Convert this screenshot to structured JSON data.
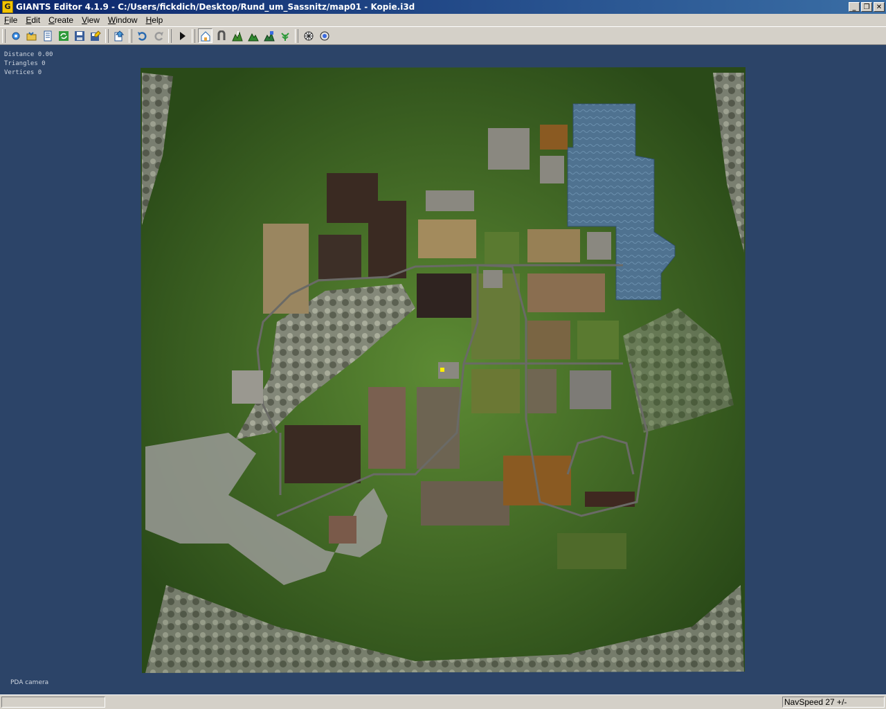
{
  "window": {
    "title": "GIANTS Editor 4.1.9 - C:/Users/fickdich/Desktop/Rund_um_Sassnitz/map01 - Kopie.i3d",
    "icon": "giants-app-icon",
    "controls": [
      "minimize",
      "restore",
      "close"
    ]
  },
  "menu": {
    "items": [
      "File",
      "Edit",
      "Create",
      "View",
      "Window",
      "Help"
    ]
  },
  "toolbar": {
    "buttons": [
      {
        "name": "new-icon"
      },
      {
        "name": "open-icon"
      },
      {
        "name": "document-icon"
      },
      {
        "name": "refresh-icon"
      },
      {
        "name": "save-icon"
      },
      {
        "name": "save-as-icon"
      },
      {
        "name": "import-icon"
      },
      {
        "name": "undo-icon"
      },
      {
        "name": "redo-icon"
      },
      {
        "name": "play-icon"
      },
      {
        "name": "select-mode-icon",
        "active": true
      },
      {
        "name": "move-mode-icon"
      },
      {
        "name": "terrain-sculpt-icon"
      },
      {
        "name": "terrain-paint-icon"
      },
      {
        "name": "terrain-smooth-icon"
      },
      {
        "name": "foliage-paint-icon"
      },
      {
        "name": "render-icon"
      },
      {
        "name": "settings-render-icon"
      }
    ]
  },
  "viewport": {
    "background_color": "#2c4468",
    "stats": {
      "distance": "Distance 0.00",
      "triangles": "Triangles 0",
      "vertices": "Vertices 0"
    },
    "camera_label": "PDA camera",
    "map_colors": {
      "grass": "#3f6a24",
      "water": "#4f7290",
      "rock": "#8d8b86",
      "field_dark": "#3a2a22",
      "field_light": "#9a8660",
      "field_orange": "#8a5a22"
    }
  },
  "statusbar": {
    "left": "",
    "navspeed": "NavSpeed 27 +/-"
  }
}
